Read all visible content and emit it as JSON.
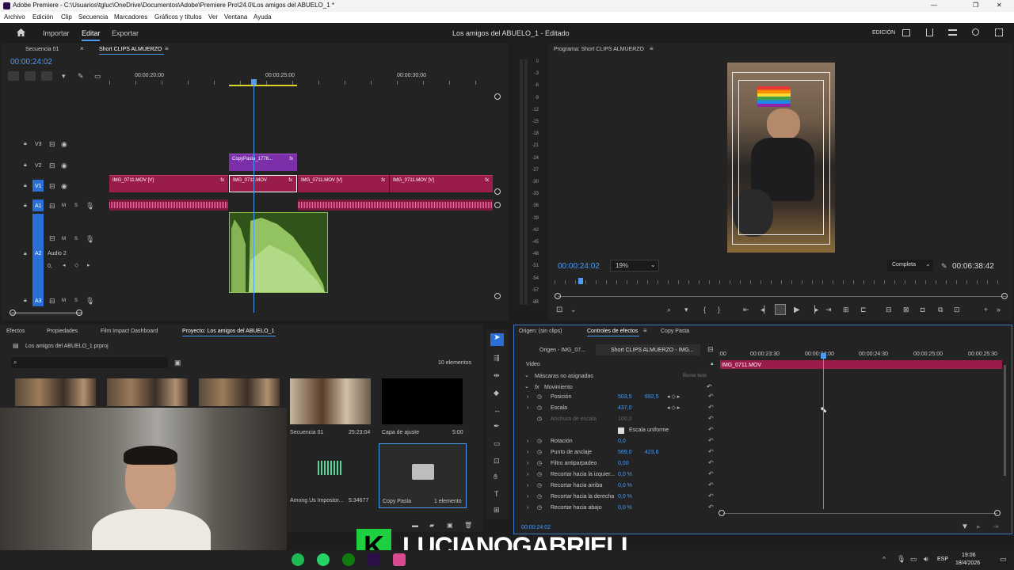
{
  "window": {
    "title": "Adobe Premiere - C:\\Usuarios\\tgluc\\OneDrive\\Documentos\\Adobe\\Premiere Pro\\24.0\\Los amigos del ABUELO_1 *",
    "minimize": "—",
    "restore": "❐",
    "close": "✕"
  },
  "menu": [
    "Archivo",
    "Edición",
    "Clip",
    "Secuencia",
    "Marcadores",
    "Gráficos y títulos",
    "Ver",
    "Ventana",
    "Ayuda"
  ],
  "header": {
    "home_icon": "home-icon",
    "tabs": [
      "Importar",
      "Editar",
      "Exportar"
    ],
    "active_tab": "Editar",
    "project_title": "Los amigos del ABUELO_1 - Editado",
    "workspace": "EDICIÓN"
  },
  "timeline": {
    "tabs": [
      "Secuencia 01",
      "Short CLIPS ALMUERZO"
    ],
    "timecode": "00:00:24:02",
    "ruler": [
      "00:00:20:00",
      "00:00:25:00",
      "00:00:30:00"
    ],
    "tracks": {
      "v3": "V3",
      "v2": "V2",
      "v1": "V1",
      "a1": "A1",
      "a2": "A2",
      "a2_name": "Audio 2",
      "a2_vol": "0,",
      "a3": "A3",
      "m": "M",
      "s": "S"
    },
    "clips": {
      "copypasta": "CopyPasta_1776...",
      "v1_a": "IMG_0711.MOV [V]",
      "v1_b": "IMG_0711.MOV",
      "v1_c": "IMG_0711.MOV [V]",
      "v1_d": "IMG_0711.MOV [V]",
      "fx": "fx"
    }
  },
  "meter": {
    "ticks": [
      "0",
      "-3",
      "-6",
      "-9",
      "-12",
      "-15",
      "-18",
      "-21",
      "-24",
      "-27",
      "-30",
      "-33",
      "-36",
      "-39",
      "-42",
      "-45",
      "-48",
      "-51",
      "-54",
      "-57",
      "dB"
    ]
  },
  "program": {
    "title": "Programa: Short CLIPS ALMUERZO",
    "timecode": "00:00:24:02",
    "zoom": "19%",
    "quality": "Completa",
    "duration": "00:06:38:42"
  },
  "project": {
    "tabs": [
      "Efectos",
      "Propiedades",
      "Film Impact Dashboard",
      "Proyecto: Los amigos del ABUELO_1"
    ],
    "file": "Los amigos del ABUELO_1.prproj",
    "search_placeholder": "",
    "count": "10 elementos",
    "items": [
      {
        "name": "Secuencia 01",
        "duration": "25:23:04"
      },
      {
        "name": "Capa de ajuste",
        "duration": "5:00"
      },
      {
        "name": "Among Us Impostor...",
        "duration": "5:34677"
      },
      {
        "name": "Copy Pasta",
        "duration": "1 elemento"
      }
    ]
  },
  "effects": {
    "tabs": [
      "Origen: (sin clips)",
      "Controles de efectos",
      "Copy Pasta"
    ],
    "source_tab": "Origen - IMG_07...",
    "seq_tab": "Short CLIPS ALMUERZO - IMG...",
    "ruler": [
      ":00",
      "00:00:23:30",
      "00:00:24:00",
      "00:00:24:30",
      "00:00:25:00",
      "00:00:25:30"
    ],
    "clip_name": "IMG_0711.MOV",
    "video_label": "Video",
    "masks": "Máscaras no asignadas",
    "clear_all": "Borrar todo",
    "movement": "Movimiento",
    "rows": [
      {
        "label": "Posición",
        "v1": "503,5",
        "v2": "692,5"
      },
      {
        "label": "Escala",
        "v1": "437,0",
        "v2": ""
      },
      {
        "label": "Anchura de escala",
        "v1": "100,0",
        "v2": ""
      },
      {
        "label": "Escala uniforme",
        "v1": "",
        "v2": ""
      },
      {
        "label": "Rotación",
        "v1": "0,0",
        "v2": ""
      },
      {
        "label": "Punto de anclaje",
        "v1": "569,0",
        "v2": "423,6"
      },
      {
        "label": "Filtro antiparpadeo",
        "v1": "0,00",
        "v2": ""
      },
      {
        "label": "Recortar hacia la izquier...",
        "v1": "0,0 %",
        "v2": ""
      },
      {
        "label": "Recortar hacia arriba",
        "v1": "0,0 %",
        "v2": ""
      },
      {
        "label": "Recortar hacia la derecha",
        "v1": "0,0 %",
        "v2": ""
      },
      {
        "label": "Recortar hacia abajo",
        "v1": "0,0 %",
        "v2": ""
      }
    ],
    "timecode": "00:00:24:02"
  },
  "overlay": {
    "logo_letter": "K",
    "channel": "LUCIANOGABRIELI"
  },
  "taskbar": {
    "lang": "ESP",
    "time": "19:06",
    "date": "18/4/2026"
  },
  "colors": {
    "accent": "#4a9cf5",
    "clip_video": "#9a1c4a",
    "clip_purple": "#7b2fa8",
    "clip_audio_green": "#3f6b1f",
    "track_blue": "#2a6fd6"
  }
}
